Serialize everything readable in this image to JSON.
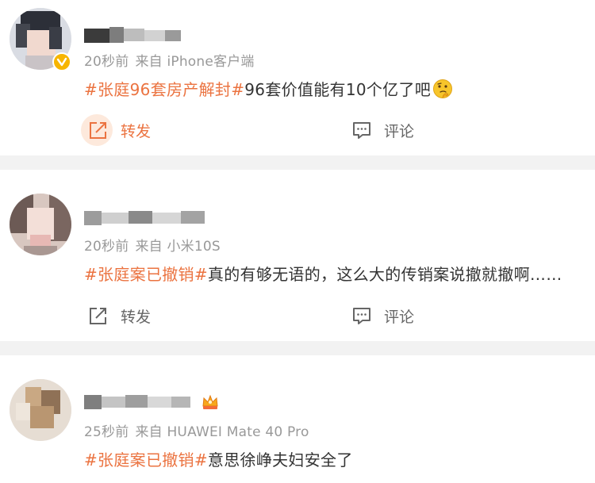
{
  "colors": {
    "accent": "#eb7340",
    "meta": "#999999",
    "text": "#333333",
    "divider": "#f2f2f2"
  },
  "posts": [
    {
      "time": "20秒前",
      "source": "来自 iPhone客户端",
      "hashtag": "#张庭96套房产解封#",
      "text": "96套价值能有10个亿了吧",
      "emoji": "thinking-face-emoji",
      "badge": "verified-v-badge",
      "actions": {
        "repost": "转发",
        "comment": "评论"
      }
    },
    {
      "time": "20秒前",
      "source": "来自 小米10S",
      "hashtag": "#张庭案已撤销#",
      "text": "真的有够无语的，这么大的传销案说撤就撤啊……",
      "actions": {
        "repost": "转发",
        "comment": "评论"
      }
    },
    {
      "time": "25秒前",
      "source": "来自 HUAWEI Mate 40 Pro",
      "hashtag": "#张庭案已撤销#",
      "text": "意思徐峥夫妇安全了",
      "badge": "crown-level-badge"
    }
  ]
}
